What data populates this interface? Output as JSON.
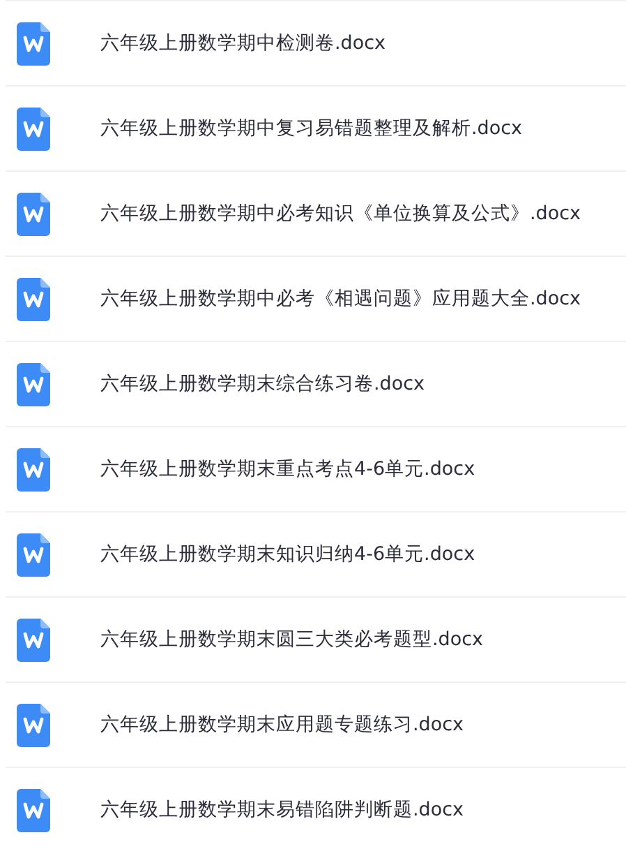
{
  "files": [
    {
      "name": "六年级上册数学期中检测卷.docx"
    },
    {
      "name": "六年级上册数学期中复习易错题整理及解析.docx"
    },
    {
      "name": "六年级上册数学期中必考知识《单位换算及公式》.docx"
    },
    {
      "name": "六年级上册数学期中必考《相遇问题》应用题大全.docx"
    },
    {
      "name": "六年级上册数学期末综合练习卷.docx"
    },
    {
      "name": "六年级上册数学期末重点考点4-6单元.docx"
    },
    {
      "name": "六年级上册数学期末知识归纳4-6单元.docx"
    },
    {
      "name": "六年级上册数学期末圆三大类必考题型.docx"
    },
    {
      "name": "六年级上册数学期末应用题专题练习.docx"
    },
    {
      "name": "六年级上册数学期末易错陷阱判断题.docx"
    }
  ]
}
